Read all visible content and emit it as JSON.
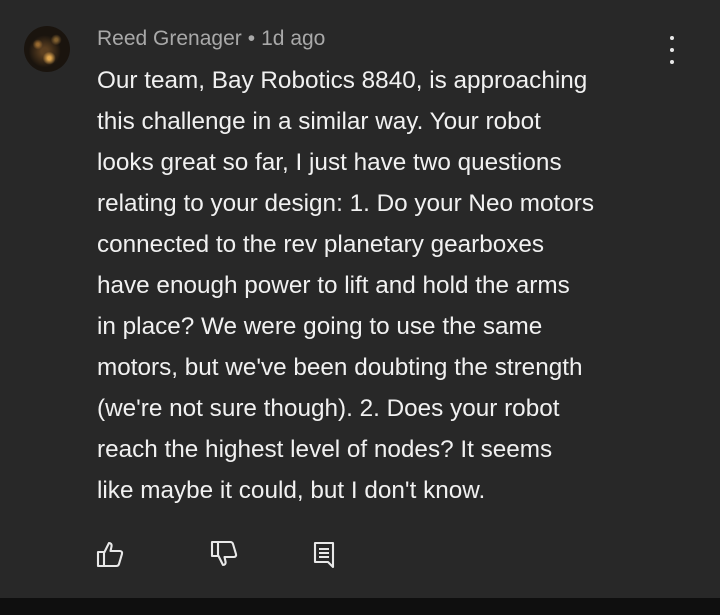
{
  "comment": {
    "author": "Reed Grenager",
    "separator": "•",
    "time": "1d ago",
    "body_lines": [
      "Our team, Bay Robotics 8840, is approaching",
      "this challenge in a similar way. Your robot",
      "looks great so far, I just have two questions",
      "relating to your design: 1. Do your Neo motors",
      "connected to the rev planetary gearboxes",
      "have enough power to lift and hold the arms",
      "in place? We were going to use the same",
      "motors, but we've been doubting the strength",
      "(we're not sure though). 2. Does your robot",
      "reach the highest level of nodes? It seems",
      "like maybe it could, but I don't know."
    ]
  },
  "icons": {
    "like": "thumbs-up-icon",
    "dislike": "thumbs-down-icon",
    "reply": "comment-icon",
    "menu": "more-vert-icon"
  },
  "colors": {
    "background": "#282828",
    "text": "#f1f1f1",
    "meta": "#a9a9a9"
  }
}
